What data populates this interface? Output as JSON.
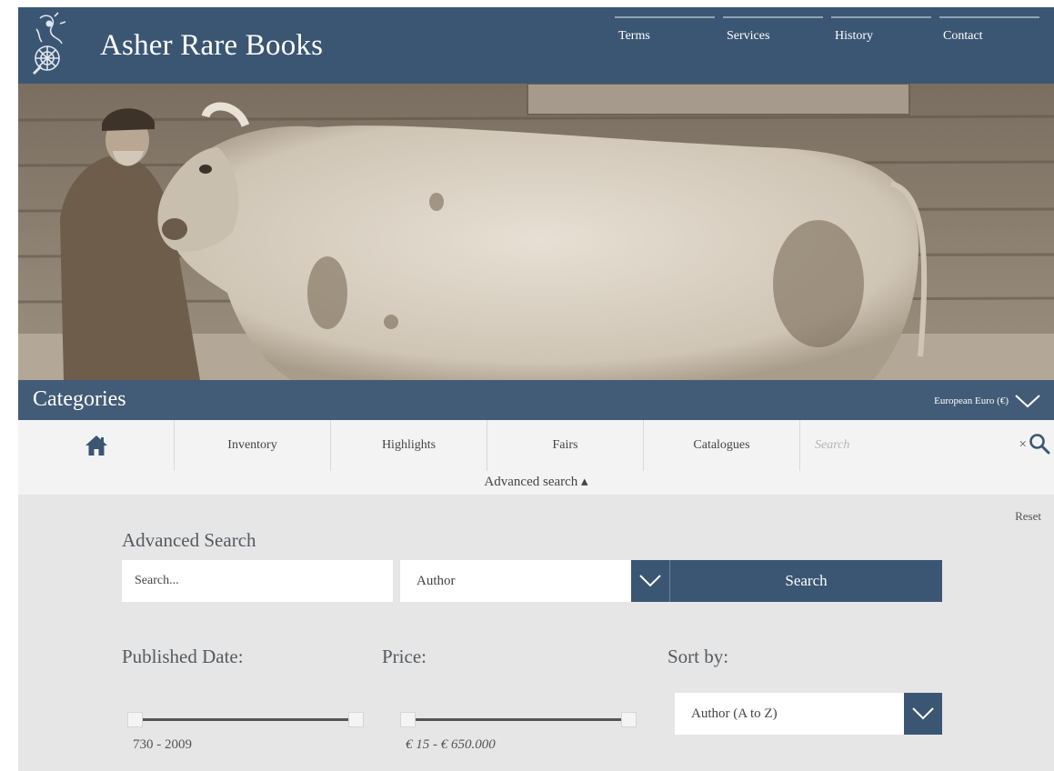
{
  "header": {
    "brand": "Asher Rare Books",
    "nav": [
      "Terms",
      "Services",
      "History",
      "Contact"
    ]
  },
  "categories": {
    "title": "Categories",
    "currency": "European Euro (€)"
  },
  "subnav": {
    "items": [
      "Inventory",
      "Highlights",
      "Fairs",
      "Catalogues"
    ],
    "search_placeholder": "Search",
    "clear": "×"
  },
  "advanced_toggle": "Advanced search ▴",
  "advanced": {
    "reset": "Reset",
    "title": "Advanced Search",
    "search_placeholder": "Search...",
    "field_select": "Author",
    "search_button": "Search",
    "published_label": "Published Date:",
    "published_range": [
      730,
      2009
    ],
    "published_value": "730 - 2009",
    "price_label": "Price:",
    "price_range": [
      15,
      650000
    ],
    "price_value": "€ 15 - € 650.000",
    "sort_label": "Sort by:",
    "sort_select": "Author (A to Z)"
  },
  "colors": {
    "brand_blue": "#3b5673",
    "panel_grey": "#e6e6e6"
  }
}
